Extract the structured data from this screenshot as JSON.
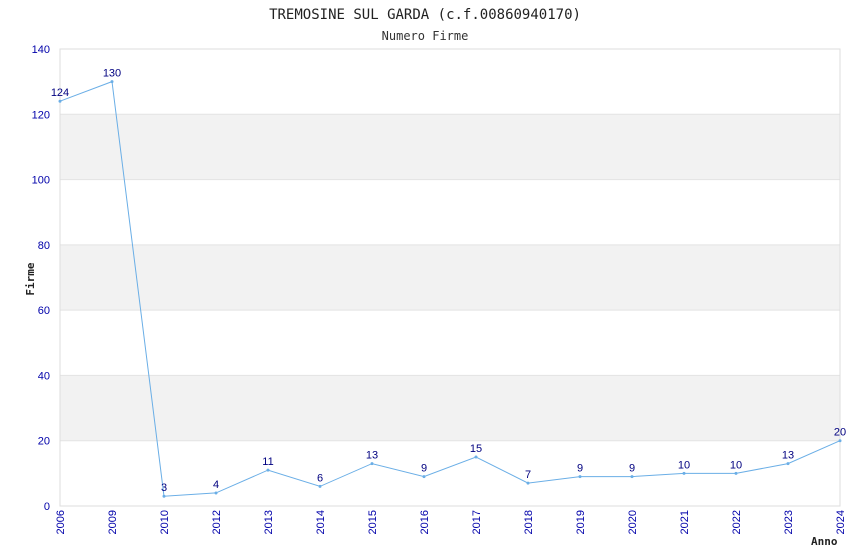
{
  "chart_data": {
    "type": "line",
    "title": "TREMOSINE SUL GARDA (c.f.00860940170)",
    "subtitle": "Numero Firme",
    "xlabel": "Anno",
    "ylabel": "Firme",
    "categories": [
      "2006",
      "2009",
      "2010",
      "2012",
      "2013",
      "2014",
      "2015",
      "2016",
      "2017",
      "2018",
      "2019",
      "2020",
      "2021",
      "2022",
      "2023",
      "2024"
    ],
    "series": [
      {
        "values": [
          124,
          130,
          3,
          4,
          11,
          6,
          13,
          9,
          15,
          7,
          9,
          9,
          10,
          10,
          13,
          20
        ]
      }
    ],
    "ylim": [
      0,
      140
    ],
    "yticks": [
      0,
      20,
      40,
      60,
      80,
      100,
      120,
      140
    ],
    "grid": true,
    "colors": {
      "line": "#6aaee6",
      "band": "#f2f2f2",
      "axis_text": "#0000aa",
      "data_label": "#000080"
    }
  }
}
